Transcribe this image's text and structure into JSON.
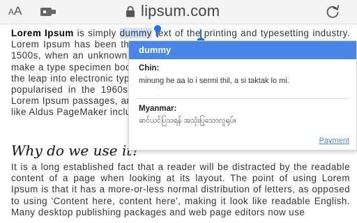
{
  "browser": {
    "text_size_small": "A",
    "text_size_large": "A",
    "url": "lipsum.com",
    "icons": [
      "text-size-icon",
      "extension-icon",
      "lock-icon",
      "reload-icon"
    ]
  },
  "article": {
    "intro_bold": "Lorem Ipsum",
    "intro_pre": " is simply ",
    "selected_word": "dummy",
    "intro_post": " text of the printing and typesetting industry. Lorem Ipsum has been the industry's standard dummy text ever since the 1500s, when an unknown printer took a galley of type and scrambled it to make a type specimen book. It has survived not only five centuries, but also the leap into electronic typesetting, remaining essentially unchanged. It was popularised in the 1960s with the release of Letraset sheets containing Lorem Ipsum passages, and more recently with desktop publishing software like Aldus PageMaker including versions of Lorem Ipsum.",
    "heading": "Why do we use it?",
    "paragraph2": "It is a long established fact that a reader will be distracted by the readable content of a page when looking at its layout. The point of using Lorem Ipsum is that it has a more-or-less normal distribution of letters, as opposed to using 'Content here, content here', making it look like readable English. Many desktop publishing packages and web page editors now use"
  },
  "popup": {
    "word": "dummy",
    "chin_label": "Chin:",
    "chin_value": "minung he aa lo i sermi thil, a si taktak lo mi.",
    "myanmar_label": "Myanmar:",
    "myanmar_value": "ဆင်ယင်ပြသရန် အသုံးပြုသောလူရုပ်။",
    "payment_link": "Payment"
  },
  "colors": {
    "accent": "#4a86e8",
    "selection": "#cfe0ff",
    "handle": "#1a73e8"
  }
}
